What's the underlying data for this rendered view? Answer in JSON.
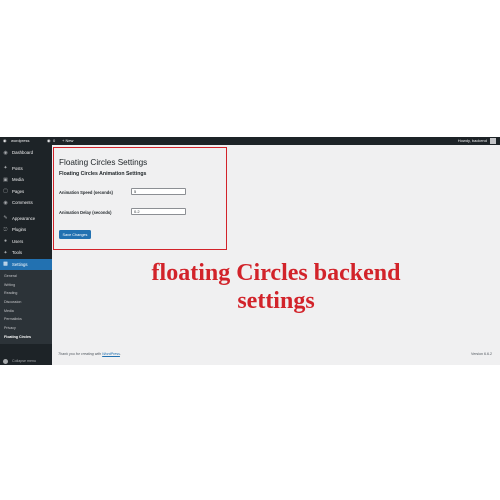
{
  "admin_bar": {
    "site_name": "wordpress",
    "comments_count": "0",
    "new_label": "+ New",
    "greeting": "Howdy, backend"
  },
  "sidebar": {
    "items": [
      {
        "label": "Dashboard",
        "icon": "dashboard-icon"
      },
      {
        "label": "Posts",
        "icon": "pin-icon"
      },
      {
        "label": "Media",
        "icon": "media-icon"
      },
      {
        "label": "Pages",
        "icon": "pages-icon"
      },
      {
        "label": "Comments",
        "icon": "comment-icon"
      },
      {
        "label": "Appearance",
        "icon": "paintbrush-icon"
      },
      {
        "label": "Plugins",
        "icon": "plugin-icon"
      },
      {
        "label": "Users",
        "icon": "user-icon"
      },
      {
        "label": "Tools",
        "icon": "wrench-icon"
      },
      {
        "label": "Settings",
        "icon": "settings-icon",
        "active": true
      }
    ],
    "submenu": [
      "General",
      "Writing",
      "Reading",
      "Discussion",
      "Media",
      "Permalinks",
      "Privacy",
      "Floating Circles"
    ],
    "current_submenu": "Floating Circles",
    "collapse_label": "Collapse menu"
  },
  "page": {
    "title": "Floating Circles Settings",
    "section_title": "Floating Circles Animation Settings",
    "fields": [
      {
        "label": "Animation Speed (seconds)",
        "value": "5"
      },
      {
        "label": "Animation Delay (seconds)",
        "value": "0.2"
      }
    ],
    "save_label": "Save Changes"
  },
  "overlay": {
    "line1": "floating Circles backend",
    "line2": "settings"
  },
  "footer": {
    "thanks_prefix": "Thank you for creating with",
    "thanks_link": "WordPress",
    "thanks_suffix": ".",
    "version": "Version 6.6.2"
  },
  "colors": {
    "admin_bar": "#1d2327",
    "sidebar": "#1d2327",
    "submenu": "#2c3338",
    "accent": "#2271b1",
    "content_bg": "#f0f0f1",
    "annotation_red": "#d2232a"
  }
}
